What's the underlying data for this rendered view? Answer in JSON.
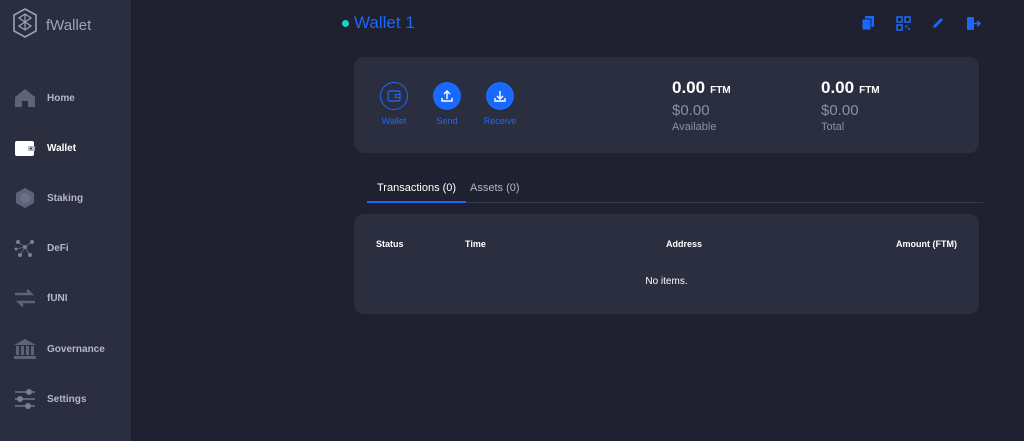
{
  "app": {
    "name": "fWallet"
  },
  "sidebar": {
    "items": [
      {
        "label": "Home",
        "icon": "home-icon"
      },
      {
        "label": "Wallet",
        "icon": "wallet-icon",
        "active": true
      },
      {
        "label": "Staking",
        "icon": "staking-icon"
      },
      {
        "label": "DeFi",
        "icon": "defi-icon"
      },
      {
        "label": "fUNI",
        "icon": "swap-icon"
      },
      {
        "label": "Governance",
        "icon": "bank-icon"
      },
      {
        "label": "Settings",
        "icon": "sliders-icon"
      }
    ]
  },
  "header": {
    "title": "Wallet 1",
    "status_color": "#19d4c4",
    "actions": [
      "copy-icon",
      "qr-code-icon",
      "edit-icon",
      "logout-icon"
    ]
  },
  "balance": {
    "actions": [
      {
        "label": "Wallet",
        "icon": "wallet-icon"
      },
      {
        "label": "Send",
        "icon": "upload-icon"
      },
      {
        "label": "Receive",
        "icon": "download-icon"
      }
    ],
    "available": {
      "amount": "0.00",
      "unit": "FTM",
      "usd": "$0.00",
      "caption": "Available"
    },
    "total": {
      "amount": "0.00",
      "unit": "FTM",
      "usd": "$0.00",
      "caption": "Total"
    }
  },
  "tabs": [
    {
      "label": "Transactions",
      "count": "(0)",
      "active": true
    },
    {
      "label": "Assets",
      "count": "(0)",
      "active": false
    }
  ],
  "table": {
    "columns": [
      "Status",
      "Time",
      "Address",
      "Amount (FTM)"
    ],
    "empty_text": "No items."
  },
  "colors": {
    "accent": "#1969ff",
    "background": "#1f2130",
    "panel": "#2b2e3f"
  }
}
